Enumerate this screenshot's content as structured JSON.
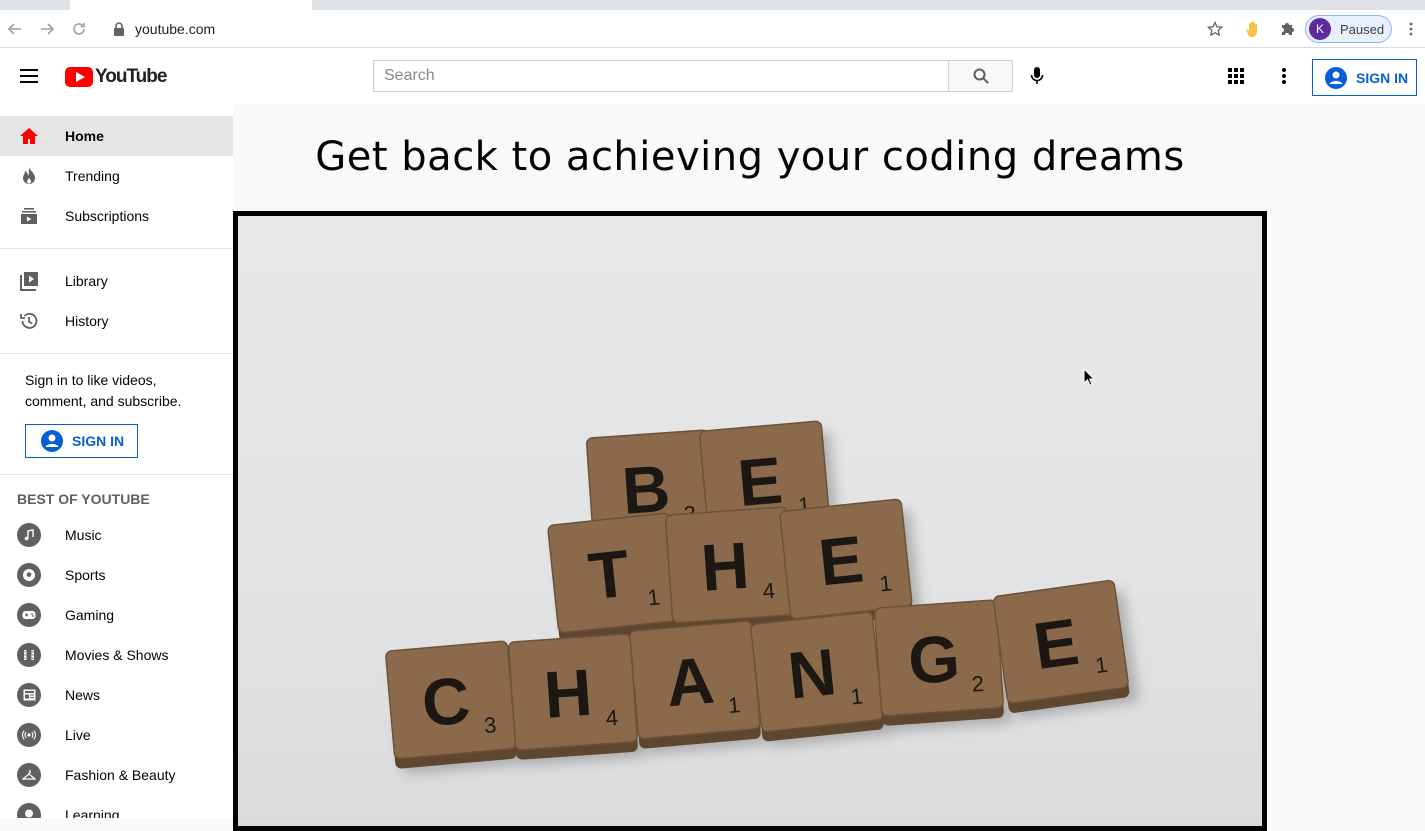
{
  "browser": {
    "url": "youtube.com",
    "profile_initial": "K",
    "profile_status": "Paused"
  },
  "header": {
    "logo_text": "YouTube",
    "search_placeholder": "Search",
    "sign_in_label": "SIGN IN"
  },
  "sidebar": {
    "primary": [
      {
        "label": "Home",
        "icon": "home-icon",
        "active": true
      },
      {
        "label": "Trending",
        "icon": "flame-icon"
      },
      {
        "label": "Subscriptions",
        "icon": "subscriptions-icon"
      }
    ],
    "library": [
      {
        "label": "Library",
        "icon": "library-icon"
      },
      {
        "label": "History",
        "icon": "history-icon"
      }
    ],
    "signin_prompt": "Sign in to like videos, comment, and subscribe.",
    "signin_label": "SIGN IN",
    "best_of_title": "BEST OF YOUTUBE",
    "best_of": [
      {
        "label": "Music",
        "icon": "music-icon"
      },
      {
        "label": "Sports",
        "icon": "sports-icon"
      },
      {
        "label": "Gaming",
        "icon": "gaming-icon"
      },
      {
        "label": "Movies & Shows",
        "icon": "movies-icon"
      },
      {
        "label": "News",
        "icon": "news-icon"
      },
      {
        "label": "Live",
        "icon": "live-icon"
      },
      {
        "label": "Fashion & Beauty",
        "icon": "fashion-icon"
      },
      {
        "label": "Learning",
        "icon": "learning-icon"
      }
    ]
  },
  "main": {
    "headline": "Get back to achieving your coding dreams",
    "tiles": [
      {
        "row": 1,
        "letter": "B",
        "score": "3"
      },
      {
        "row": 1,
        "letter": "E",
        "score": "1"
      },
      {
        "row": 2,
        "letter": "T",
        "score": "1"
      },
      {
        "row": 2,
        "letter": "H",
        "score": "4"
      },
      {
        "row": 2,
        "letter": "E",
        "score": "1"
      },
      {
        "row": 3,
        "letter": "C",
        "score": "3"
      },
      {
        "row": 3,
        "letter": "H",
        "score": "4"
      },
      {
        "row": 3,
        "letter": "A",
        "score": "1"
      },
      {
        "row": 3,
        "letter": "N",
        "score": "1"
      },
      {
        "row": 3,
        "letter": "G",
        "score": "2"
      },
      {
        "row": 3,
        "letter": "E",
        "score": "1"
      }
    ]
  },
  "colors": {
    "brand_red": "#ff0000",
    "link_blue": "#065fd4",
    "tile_wood": "#8a6a4a"
  }
}
